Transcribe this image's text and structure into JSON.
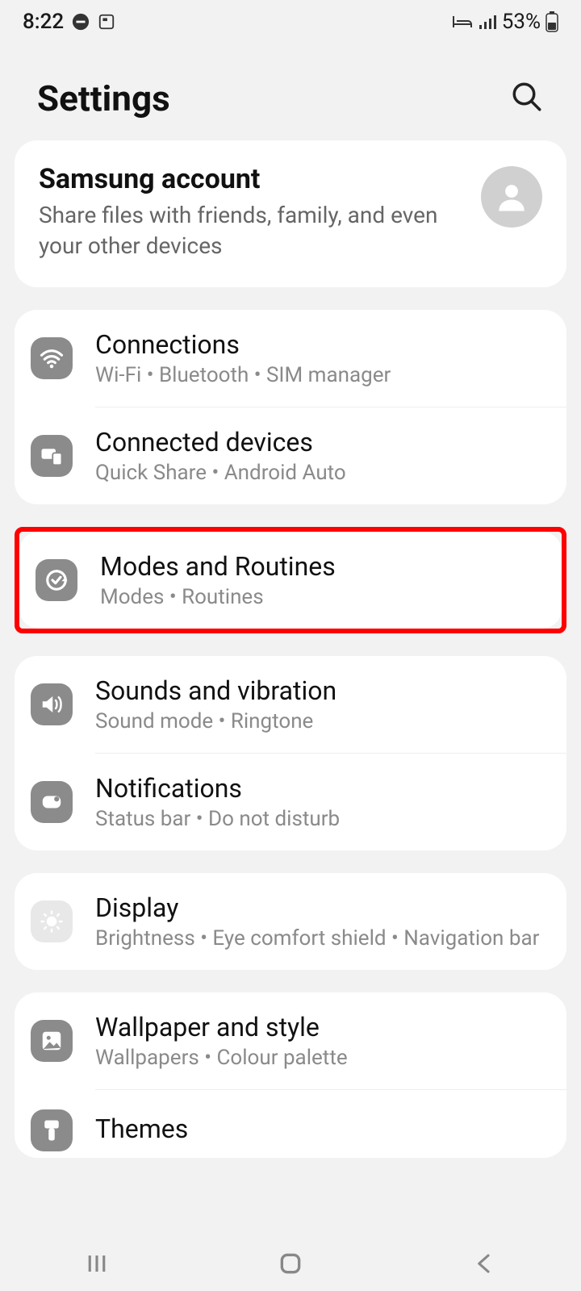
{
  "status": {
    "time": "8:22",
    "battery": "53%"
  },
  "header": {
    "title": "Settings"
  },
  "account": {
    "title": "Samsung account",
    "desc": "Share files with friends, family, and even your other devices"
  },
  "groups": [
    {
      "items": [
        {
          "title": "Connections",
          "sub": "Wi-Fi  •  Bluetooth  •  SIM manager",
          "icon": "wifi"
        },
        {
          "title": "Connected devices",
          "sub": "Quick Share  •  Android Auto",
          "icon": "devices"
        }
      ]
    },
    {
      "highlight": true,
      "items": [
        {
          "title": "Modes and Routines",
          "sub": "Modes  •  Routines",
          "icon": "modes"
        }
      ]
    },
    {
      "items": [
        {
          "title": "Sounds and vibration",
          "sub": "Sound mode  •  Ringtone",
          "icon": "sound"
        },
        {
          "title": "Notifications",
          "sub": "Status bar  •  Do not disturb",
          "icon": "notif"
        }
      ]
    },
    {
      "items": [
        {
          "title": "Display",
          "sub": "Brightness  •  Eye comfort shield  •  Navigation bar",
          "icon": "display",
          "light": true
        }
      ]
    },
    {
      "items": [
        {
          "title": "Wallpaper and style",
          "sub": "Wallpapers  •  Colour palette",
          "icon": "wallpaper"
        },
        {
          "title": "Themes",
          "sub": "",
          "icon": "themes"
        }
      ]
    }
  ]
}
